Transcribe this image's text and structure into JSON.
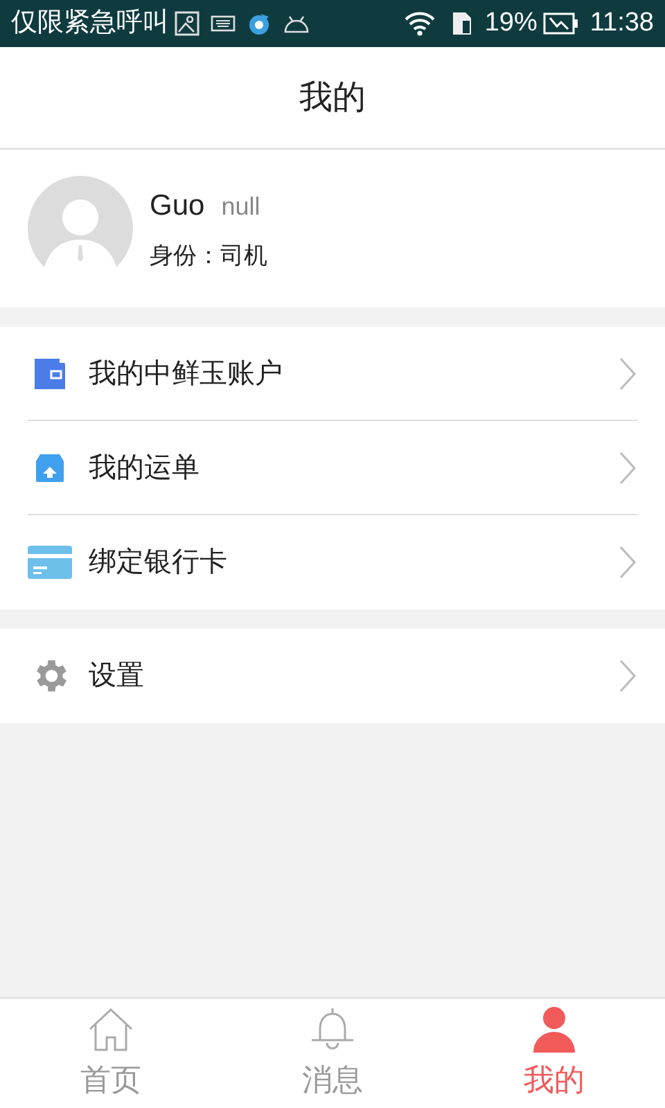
{
  "status_bar": {
    "carrier": "仅限紧急呼叫",
    "battery": "19%",
    "time": "11:38"
  },
  "header": {
    "title": "我的"
  },
  "profile": {
    "name": "Guo",
    "nickname": "null",
    "role": "身份：司机"
  },
  "menu_groups": [
    [
      {
        "kind": "wallet",
        "label": "我的中鲜玉账户"
      },
      {
        "kind": "box",
        "label": "我的运单"
      },
      {
        "kind": "card",
        "label": "绑定银行卡"
      }
    ],
    [
      {
        "kind": "gear",
        "label": "设置"
      }
    ]
  ],
  "tabs": [
    {
      "kind": "home",
      "label": "首页",
      "selected": false
    },
    {
      "kind": "bell",
      "label": "消息",
      "selected": false
    },
    {
      "kind": "person",
      "label": "我的",
      "selected": true
    }
  ]
}
